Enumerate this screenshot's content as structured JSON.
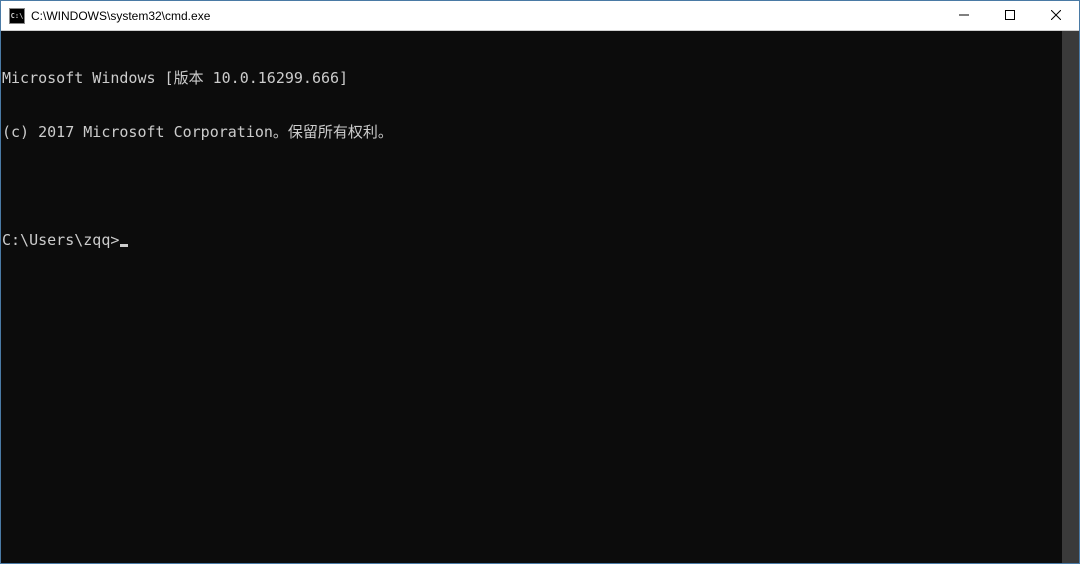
{
  "titlebar": {
    "icon_label": "C:\\",
    "title": "C:\\WINDOWS\\system32\\cmd.exe"
  },
  "terminal": {
    "line1": "Microsoft Windows [版本 10.0.16299.666]",
    "line2": "(c) 2017 Microsoft Corporation。保留所有权利。",
    "blank": "",
    "prompt": "C:\\Users\\zqq>"
  }
}
